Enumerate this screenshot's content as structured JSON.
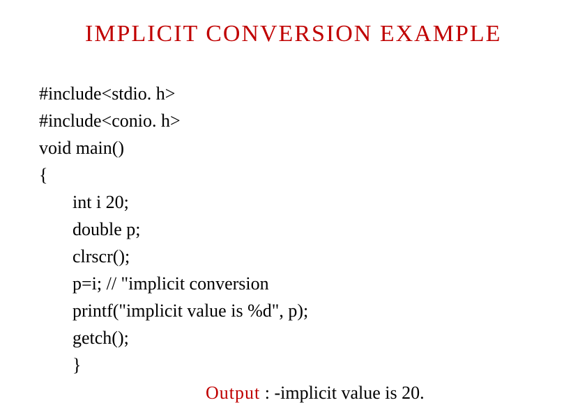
{
  "title": "IMPLICIT CONVERSION EXAMPLE",
  "code": {
    "line1": "#include<stdio. h>",
    "line2": "#include<conio. h>",
    "line3": "void main()",
    "line4": "{",
    "line5": "int i 20;",
    "line6": "double p;",
    "line7": "clrscr();",
    "line8": "p=i; // \"implicit conversion",
    "line9": "printf(\"implicit value is %d\", p);",
    "line10": "getch();",
    "line11": "}"
  },
  "output": {
    "label": "Output",
    "text": " : -implicit value is 20."
  }
}
